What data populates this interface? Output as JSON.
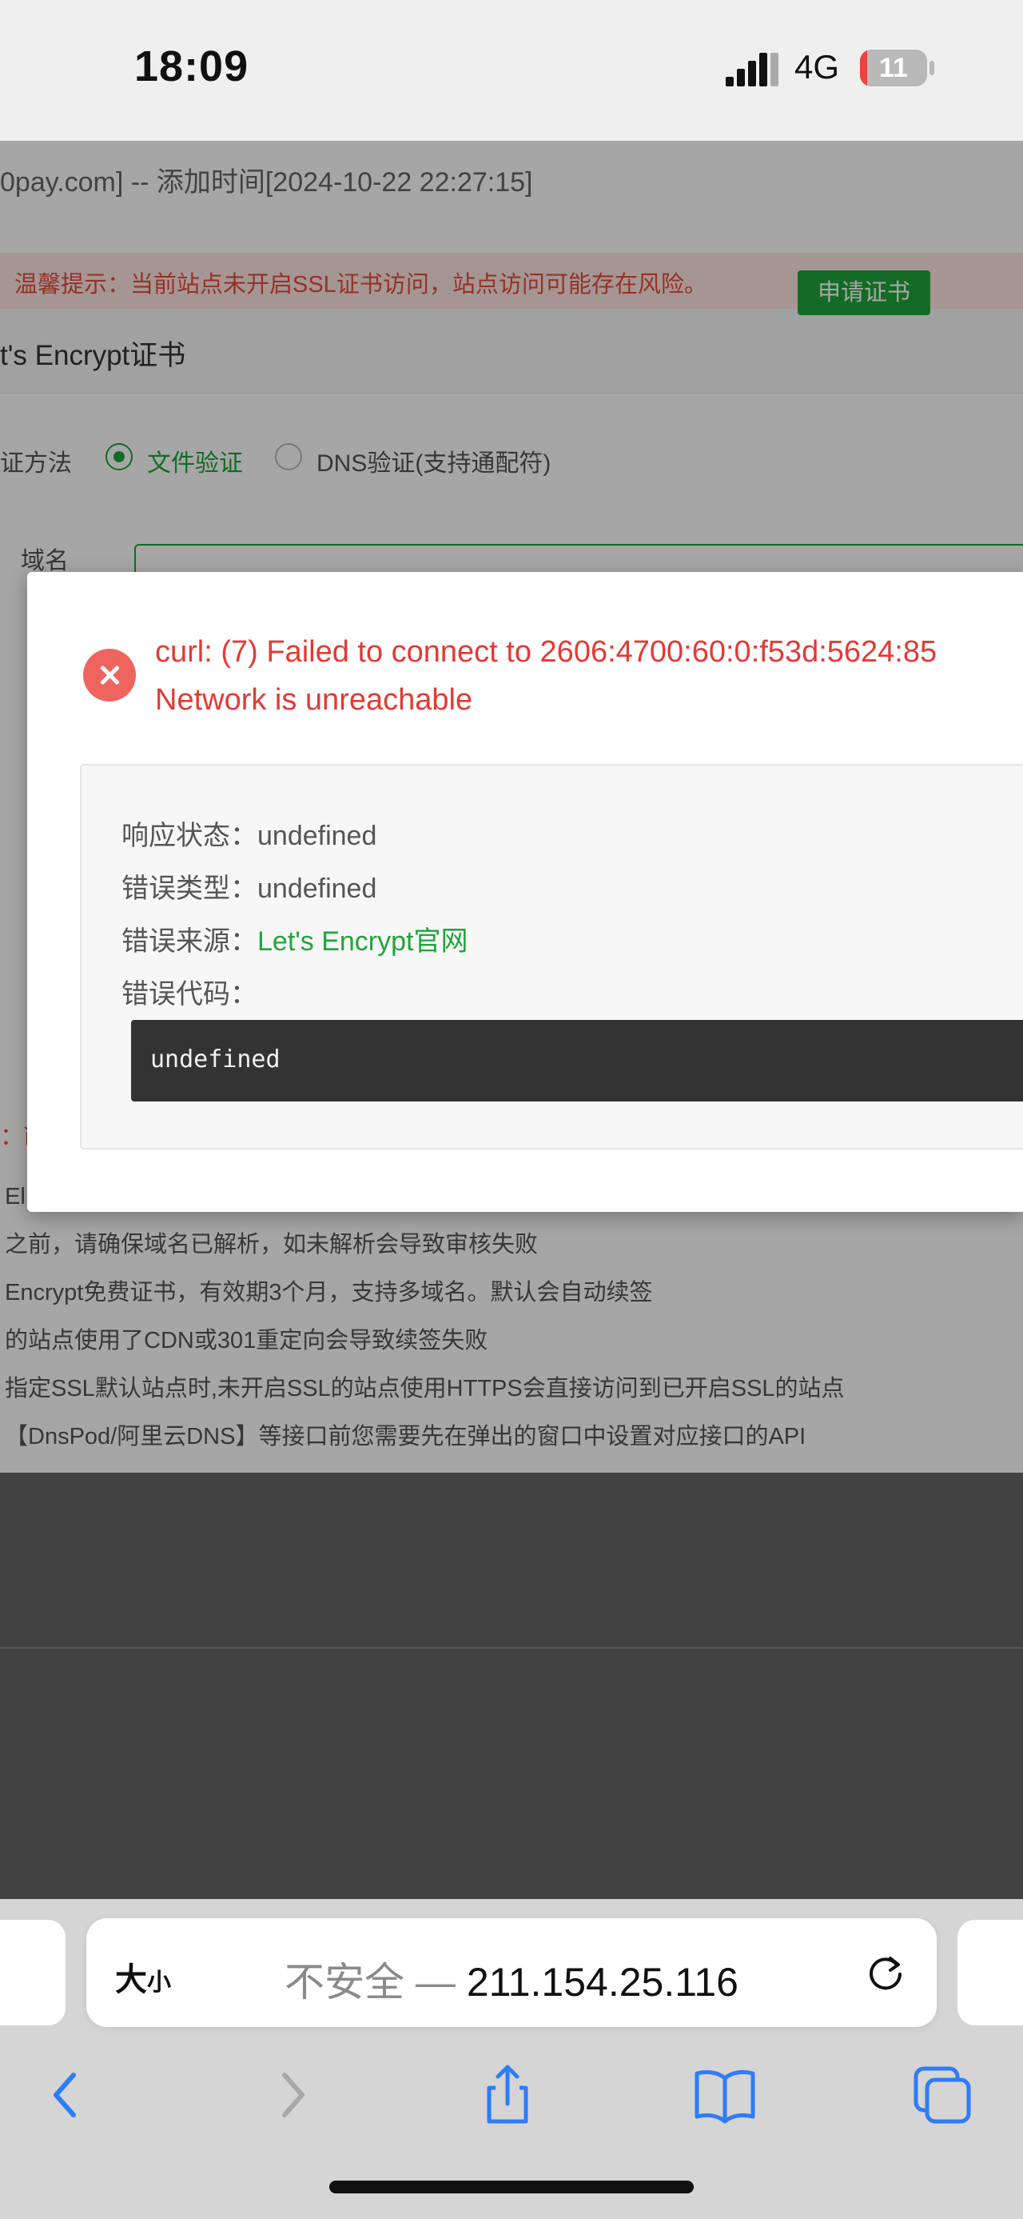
{
  "status_bar": {
    "time": "18:09",
    "network": "4G",
    "battery": "11",
    "battery_level_percent": 11
  },
  "background_page": {
    "site_line": "0pay.com] -- 添加时间[2024-10-22 22:27:15]",
    "ssl_warning": "温馨提示：当前站点未开启SSL证书访问，站点访问可能存在风险。",
    "apply_cert_button": "申请证书",
    "ssl_panel_title": "t's Encrypt证书",
    "verify_method_label": "证方法",
    "verify_options": [
      "文件验证",
      "DNS验证(支持通配符)"
    ],
    "verify_selected": "文件验证",
    "domain_label": "域名",
    "tip_marker": "：ì",
    "tips": [
      "El",
      "之前，请确保域名已解析，如未解析会导致审核失败",
      "Encrypt免费证书，有效期3个月，支持多域名。默认会自动续签",
      "的站点使用了CDN或301重定向会导致续签失败",
      "指定SSL默认站点时,未开启SSL的站点使用HTTPS会直接访问到已开启SSL的站点",
      "【DnsPod/阿里云DNS】等接口前您需要先在弹出的窗口中设置对应接口的API"
    ]
  },
  "error_dialog": {
    "message_line1": "curl: (7) Failed to connect to 2606:4700:60:0:f53d:5624:85",
    "message_line2": "Network is unreachable",
    "response_status_label": "响应状态：",
    "response_status_value": "undefined",
    "error_type_label": "错误类型：",
    "error_type_value": "undefined",
    "error_source_label": "错误来源：",
    "error_source_value": "Let's Encrypt官网",
    "error_code_label": "错误代码：",
    "error_code_value": "undefined"
  },
  "browser": {
    "text_size_button": "大",
    "text_size_small": "小",
    "insecure_label": "不安全 — ",
    "url": "211.154.25.116",
    "icons": [
      "back-icon",
      "forward-icon",
      "share-icon",
      "bookmarks-icon",
      "tabs-icon",
      "reload-icon"
    ]
  },
  "colors": {
    "accent_green": "#20a53a",
    "error_red": "#e33a35",
    "error_icon": "#f0645f"
  }
}
